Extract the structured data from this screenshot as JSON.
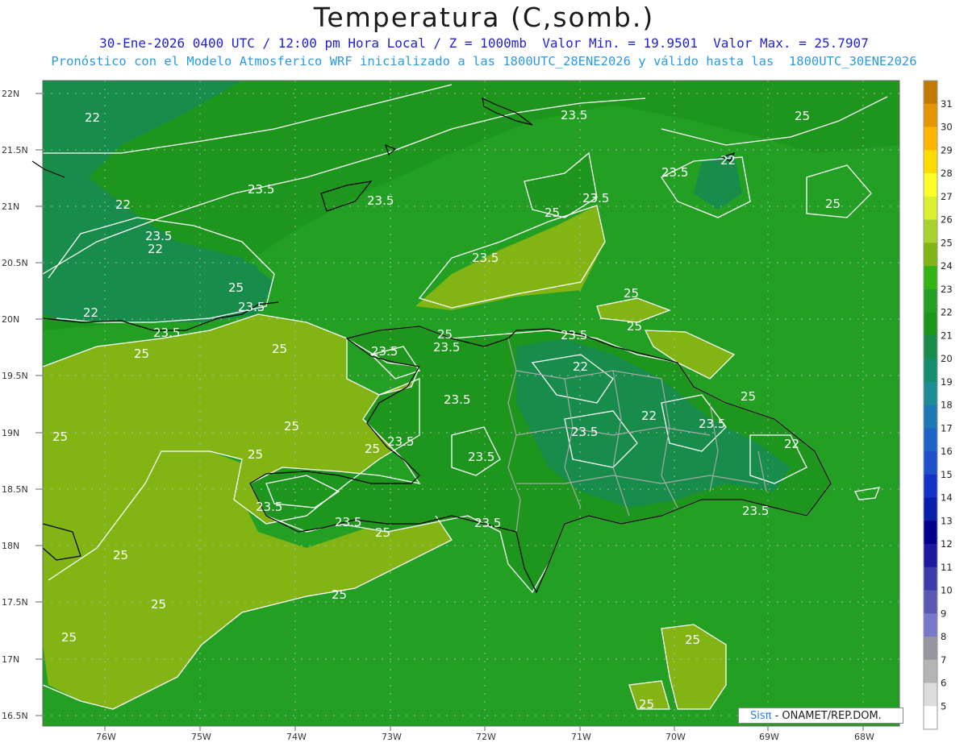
{
  "title": "Temperatura (C,somb.)",
  "subtitle1": "30-Ene-2026 0400 UTC / 12:00 pm Hora Local / Z = 1000mb  Valor Min. = 19.9501  Valor Max. = 25.7907",
  "subtitle2": "Pronóstico con el Modelo Atmosferico WRF inicializado a las 1800UTC_28ENE2026 y válido hasta las  1800UTC_30ENE2026",
  "lat_labels": [
    "22N",
    "21.5N",
    "21N",
    "20.5N",
    "20N",
    "19.5N",
    "19N",
    "18.5N",
    "18N",
    "17.5N",
    "17N",
    "16.5N"
  ],
  "lon_labels": [
    "76W",
    "75W",
    "74W",
    "73W",
    "72W",
    "71W",
    "70W",
    "69W",
    "68W"
  ],
  "colorbar_labels": [
    "31",
    "30",
    "29",
    "28",
    "27",
    "26",
    "25",
    "24",
    "23",
    "22",
    "21",
    "20",
    "19",
    "18",
    "17",
    "16",
    "15",
    "14",
    "13",
    "12",
    "11",
    "10",
    "9",
    "8",
    "7",
    "6",
    "5"
  ],
  "colorbar_colors": [
    "#c07a00",
    "#e29600",
    "#ffb400",
    "#ffdc00",
    "#ffff28",
    "#dcf032",
    "#a8d22d",
    "#82b414",
    "#32b414",
    "#23a023",
    "#1e961e",
    "#178c4b",
    "#148c6e",
    "#1e8c96",
    "#1e78b4",
    "#1e64c8",
    "#1e50c8",
    "#1432c8",
    "#0a1eaa",
    "#00008c",
    "#1a1aa0",
    "#3c3ca8",
    "#5a5ab4",
    "#7878c8",
    "#9696a0",
    "#b4b4b4",
    "#dcdcdc",
    "#ffffff"
  ],
  "contour_labels": [
    "22",
    "23.5",
    "23.5",
    "25",
    "23.5",
    "25",
    "22",
    "23.5",
    "22",
    "23.5",
    "22",
    "23.5",
    "25",
    "23.5",
    "25",
    "25",
    "23.5",
    "25",
    "23.5",
    "22",
    "25",
    "23.5",
    "25",
    "23.5",
    "23.5",
    "25",
    "23.5",
    "23.5",
    "23.5",
    "23.5",
    "23.5",
    "25",
    "25",
    "25",
    "25",
    "25",
    "25",
    "25",
    "25",
    "25",
    "23.5",
    "22",
    "25",
    "23.5",
    "22",
    "23.5",
    "22",
    "23.5",
    "25",
    "25"
  ],
  "credit_logo": "Sisπ",
  "credit_text": " - ONAMET/REP.DOM.",
  "colors": {
    "map_green": "#23a023",
    "olive": "#82b414",
    "dark_green": "#1e961e",
    "teal": "#178c4b"
  }
}
